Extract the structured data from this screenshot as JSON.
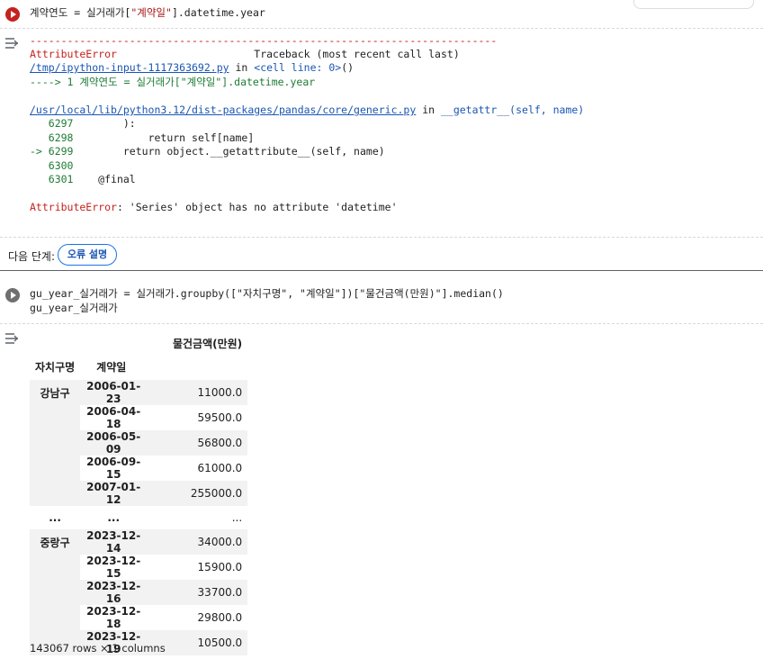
{
  "cell1": {
    "code": "계약연도 = 실거래가[\"계약일\"].datetime.year",
    "code_prefix": "계약연도 = 실거래가[",
    "code_string": "\"계약일\"",
    "code_suffix": "].datetime.year"
  },
  "traceback": {
    "dashes": "---------------------------------------------------------------------------",
    "error_name": "AttributeError",
    "traceback_label": "Traceback (most recent call last)",
    "file1": "/tmp/ipython-input-1117363692.py",
    "in_text": " in ",
    "cell_line": "<cell line: 0>",
    "paren": "()",
    "arrow_line": "----> 1 계약연도 = 실거래가[\"계약일\"].datetime.year",
    "file2": "/usr/local/lib/python3.12/dist-packages/pandas/core/generic.py",
    "func2": "__getattr__",
    "args2": "(self, name)",
    "lines": [
      {
        "no": "6297",
        "prefix": "   ",
        "code": "        ):"
      },
      {
        "no": "6298",
        "prefix": "   ",
        "code": "            return self[name]"
      },
      {
        "no": "6299",
        "prefix": "-> ",
        "code": "        return object.__getattribute__(self, name)"
      },
      {
        "no": "6300",
        "prefix": "   ",
        "code": ""
      },
      {
        "no": "6301",
        "prefix": "   ",
        "code": "    @final"
      }
    ],
    "final_error": "AttributeError",
    "final_message": ": 'Series' object has no attribute 'datetime'"
  },
  "next_steps": {
    "label": "다음 단계:",
    "button": "오류 설명"
  },
  "cell2": {
    "line1": "gu_year_실거래가 = 실거래가.groupby([\"자치구명\", \"계약일\"])[\"물건금액(만원)\"].median()",
    "line2": "gu_year_실거래가"
  },
  "dataframe": {
    "column": "물건금액(만원)",
    "index_names": [
      "자치구명",
      "계약일"
    ],
    "groups": [
      {
        "name": "강남구",
        "rows": [
          {
            "date": "2006-01-23",
            "value": "11000.0"
          },
          {
            "date": "2006-04-18",
            "value": "59500.0"
          },
          {
            "date": "2006-05-09",
            "value": "56800.0"
          },
          {
            "date": "2006-09-15",
            "value": "61000.0"
          },
          {
            "date": "2007-01-12",
            "value": "255000.0"
          }
        ]
      },
      {
        "name": "...",
        "rows": [
          {
            "date": "...",
            "value": "..."
          }
        ]
      },
      {
        "name": "중랑구",
        "rows": [
          {
            "date": "2023-12-14",
            "value": "34000.0"
          },
          {
            "date": "2023-12-15",
            "value": "15900.0"
          },
          {
            "date": "2023-12-16",
            "value": "33700.0"
          },
          {
            "date": "2023-12-18",
            "value": "29800.0"
          },
          {
            "date": "2023-12-19",
            "value": "10500.0"
          }
        ]
      }
    ],
    "footer": "143067 rows × 1 columns"
  },
  "colors": {
    "error": "#c5221f",
    "link": "#1a56b3",
    "accent": "#1a73e8"
  }
}
